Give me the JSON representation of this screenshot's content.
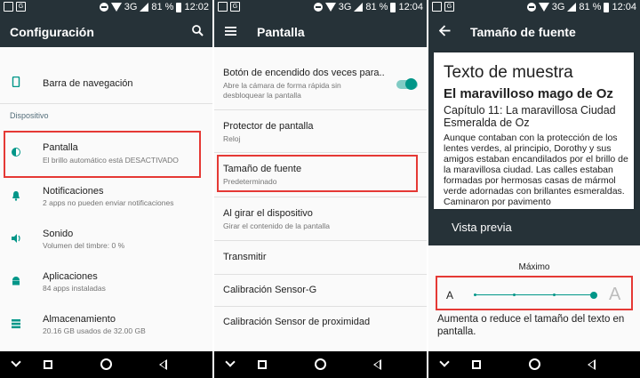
{
  "status": {
    "battery": "81 %",
    "net": "3G",
    "times": [
      "12:02",
      "12:04",
      "12:04"
    ]
  },
  "panel1": {
    "title": "Configuración",
    "items": [
      {
        "title": "Barra de navegación",
        "sub": ""
      },
      {
        "title": "Pantalla",
        "sub": "El brillo automático está DESACTIVADO"
      },
      {
        "title": "Notificaciones",
        "sub": "2 apps no pueden enviar notificaciones"
      },
      {
        "title": "Sonido",
        "sub": "Volumen del timbre: 0 %"
      },
      {
        "title": "Aplicaciones",
        "sub": "84 apps instaladas"
      },
      {
        "title": "Almacenamiento",
        "sub": "20.16 GB usados de 32.00 GB"
      }
    ],
    "section": "Dispositivo"
  },
  "panel2": {
    "title": "Pantalla",
    "items": [
      {
        "title": "Botón de encendido dos veces para..",
        "sub": "Abre la cámara de forma rápida sin desbloquear la pantalla"
      },
      {
        "title": "Protector de pantalla",
        "sub": "Reloj"
      },
      {
        "title": "Tamaño de fuente",
        "sub": "Predeterminado"
      },
      {
        "title": "Al girar el dispositivo",
        "sub": "Girar el contenido de la pantalla"
      },
      {
        "title": "Transmitir",
        "sub": ""
      },
      {
        "title": "Calibración Sensor-G",
        "sub": ""
      },
      {
        "title": "Calibración Sensor de proximidad",
        "sub": ""
      }
    ],
    "toggle_on": true
  },
  "panel3": {
    "title": "Tamaño de fuente",
    "preview": {
      "h1": "Texto de muestra",
      "h2": "El maravilloso mago de Oz",
      "h3": "Capítulo 11: La maravillosa Ciudad Esmeralda de Oz",
      "body": "Aunque contaban con la protección de los lentes verdes, al principio, Dorothy y sus amigos estaban encandilados por el brillo de la maravillosa ciudad. Las calles estaban formadas por hermosas casas de mármol verde adornadas con brillantes esmeraldas. Caminaron por pavimento"
    },
    "preview_label": "Vista previa",
    "slider": {
      "label": "Máximo",
      "small_a": "A",
      "large_a": "A",
      "level_index": 3,
      "steps": 4
    },
    "description": "Aumenta o reduce el tamaño del texto en pantalla."
  },
  "colors": {
    "appbar": "#263238",
    "accent": "#009688",
    "highlight": "#e53935"
  }
}
